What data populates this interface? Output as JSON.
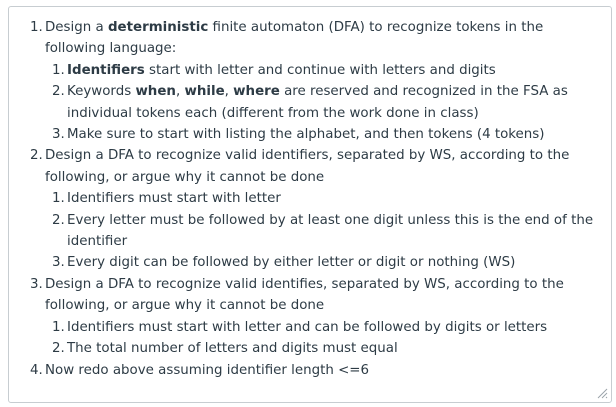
{
  "items": [
    {
      "num": "1.",
      "parts": [
        {
          "t": "Design a ",
          "b": false
        },
        {
          "t": "deterministic",
          "b": true
        },
        {
          "t": " finite automaton (DFA) to recognize tokens in the following language:",
          "b": false
        }
      ],
      "sub": [
        {
          "num": "1.",
          "parts": [
            {
              "t": "Identifiers",
              "b": true
            },
            {
              "t": " start with letter and continue with letters and digits",
              "b": false
            }
          ]
        },
        {
          "num": "2.",
          "parts": [
            {
              "t": "Keywords ",
              "b": false
            },
            {
              "t": "when",
              "b": true
            },
            {
              "t": ", ",
              "b": false
            },
            {
              "t": "while",
              "b": true
            },
            {
              "t": ", ",
              "b": false
            },
            {
              "t": "where",
              "b": true
            },
            {
              "t": " are reserved and recognized in the FSA as individual tokens each (different from the work done in class)",
              "b": false
            }
          ]
        },
        {
          "num": "3.",
          "parts": [
            {
              "t": "Make sure to start with listing the alphabet, and then tokens (4 tokens)",
              "b": false
            }
          ]
        }
      ]
    },
    {
      "num": "2.",
      "parts": [
        {
          "t": "Design a DFA to recognize valid identifiers, separated by WS, according to the following, or argue why it cannot be done",
          "b": false
        }
      ],
      "sub": [
        {
          "num": "1.",
          "parts": [
            {
              "t": "Identifiers must start with letter",
              "b": false
            }
          ]
        },
        {
          "num": "2.",
          "parts": [
            {
              "t": "Every letter must be followed by at least one digit unless this is the end of the identifier",
              "b": false
            }
          ]
        },
        {
          "num": "3.",
          "parts": [
            {
              "t": "Every digit can be followed by either letter or digit or nothing (WS)",
              "b": false
            }
          ]
        }
      ]
    },
    {
      "num": "3.",
      "parts": [
        {
          "t": "Design a DFA to recognize valid identifies, separated by WS, according to the following, or argue why it cannot be done",
          "b": false
        }
      ],
      "sub": [
        {
          "num": "1.",
          "parts": [
            {
              "t": "Identifiers must start with letter and can be followed by digits or letters",
              "b": false
            }
          ]
        },
        {
          "num": "2.",
          "parts": [
            {
              "t": "The total number of letters and digits must equal",
              "b": false
            }
          ]
        }
      ]
    },
    {
      "num": "4.",
      "parts": [
        {
          "t": "Now redo above assuming identifier length <=6",
          "b": false
        }
      ],
      "sub": []
    }
  ]
}
